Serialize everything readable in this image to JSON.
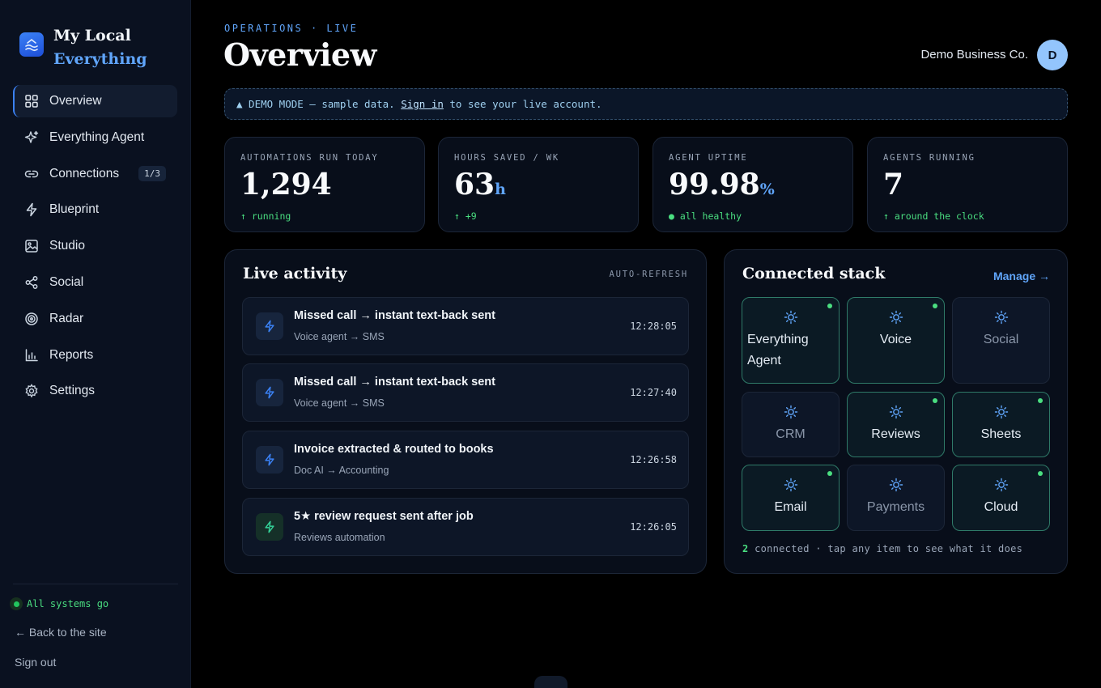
{
  "brand": {
    "line1": "My Local",
    "line2": "Everything"
  },
  "sidebar": {
    "items": [
      {
        "label": "Overview",
        "icon": "grid-icon",
        "active": true
      },
      {
        "label": "Everything Agent",
        "icon": "sparkle-icon"
      },
      {
        "label": "Connections",
        "icon": "link-icon",
        "badge": "1/3"
      },
      {
        "label": "Blueprint",
        "icon": "bolt-icon"
      },
      {
        "label": "Studio",
        "icon": "image-icon"
      },
      {
        "label": "Social",
        "icon": "share-icon"
      },
      {
        "label": "Radar",
        "icon": "target-icon"
      },
      {
        "label": "Reports",
        "icon": "bar-chart-icon"
      },
      {
        "label": "Settings",
        "icon": "gear-icon"
      }
    ],
    "status": "All systems go",
    "back_link": "← Back to the site",
    "sign_out": "Sign out"
  },
  "header": {
    "eyebrow": "OPERATIONS · LIVE",
    "title": "Overview",
    "org": "Demo Business Co.",
    "avatar_initial": "D"
  },
  "banner": {
    "prefix": "▲ DEMO MODE — sample data.",
    "link": "Sign in",
    "suffix": "to see your live account."
  },
  "stats": [
    {
      "label": "AUTOMATIONS RUN TODAY",
      "value": "1,294",
      "unit": "",
      "sub": "↑ running"
    },
    {
      "label": "HOURS SAVED / WK",
      "value": "63",
      "unit": "h",
      "sub": "↑ +9"
    },
    {
      "label": "AGENT UPTIME",
      "value": "99.98",
      "unit": "%",
      "sub": "● all healthy"
    },
    {
      "label": "AGENTS RUNNING",
      "value": "7",
      "unit": "",
      "sub": "↑ around the clock"
    }
  ],
  "activity": {
    "title": "Live activity",
    "badge": "AUTO-REFRESH",
    "items": [
      {
        "title": "Missed call → instant text-back sent",
        "sub": "Voice agent → SMS",
        "time": "12:28:05",
        "icon": "bolt-icon",
        "color": "#3b82f6"
      },
      {
        "title": "Missed call → instant text-back sent",
        "sub": "Voice agent → SMS",
        "time": "12:27:40",
        "icon": "bolt-icon",
        "color": "#3b82f6"
      },
      {
        "title": "Invoice extracted & routed to books",
        "sub": "Doc AI → Accounting",
        "time": "12:26:58",
        "icon": "bolt-icon",
        "color": "#3b82f6"
      },
      {
        "title": "5★ review request sent after job",
        "sub": "Reviews automation",
        "time": "12:26:05",
        "icon": "bolt-icon",
        "color": "#34d399"
      }
    ]
  },
  "stack": {
    "title": "Connected stack",
    "manage": "Manage →",
    "tiles": [
      {
        "label": "Everything Agent",
        "connected": true
      },
      {
        "label": "Voice",
        "connected": true
      },
      {
        "label": "Social",
        "connected": false
      },
      {
        "label": "CRM",
        "connected": false
      },
      {
        "label": "Reviews",
        "connected": true
      },
      {
        "label": "Sheets",
        "connected": true
      },
      {
        "label": "Email",
        "connected": true
      },
      {
        "label": "Payments",
        "connected": false
      },
      {
        "label": "Cloud",
        "connected": true
      }
    ],
    "footer_count": "2",
    "footer_text": "connected · tap any item to see what it does"
  },
  "colors": {
    "accent": "#60a5fa",
    "success": "#4ade80",
    "background": "#000000",
    "sidebar": "#0a1120"
  }
}
